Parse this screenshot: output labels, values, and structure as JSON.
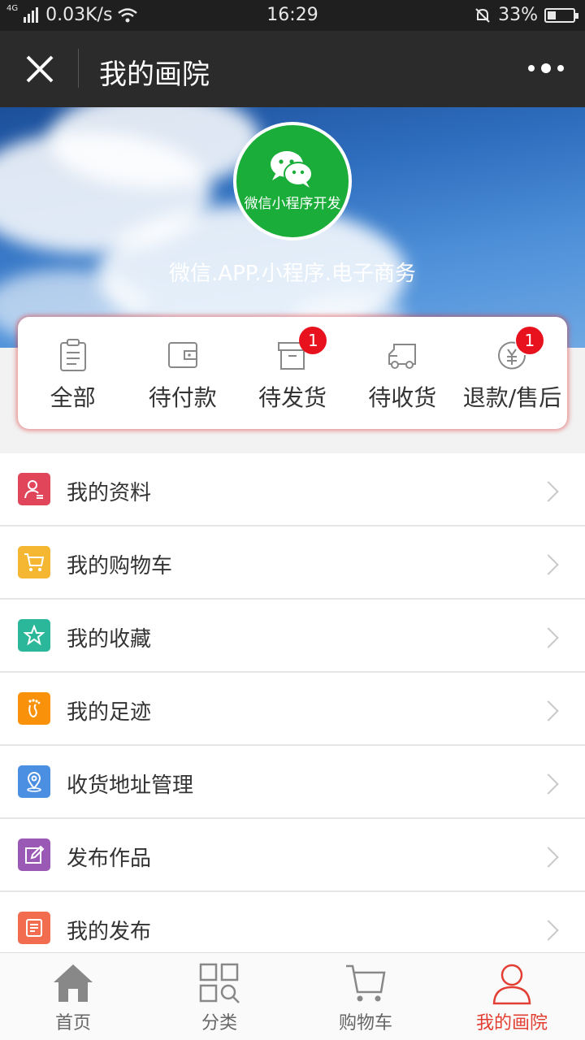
{
  "status_bar": {
    "network_type": "4G",
    "speed": "0.03K/s",
    "time": "16:29",
    "battery": "33%",
    "battery_level": 0.33
  },
  "title_bar": {
    "title": "我的画院"
  },
  "profile": {
    "avatar_text": "微信小程序开发",
    "subtitle": "微信.APP.小程序.电子商务"
  },
  "orders": [
    {
      "label": "全部",
      "icon": "clipboard-icon",
      "badge": ""
    },
    {
      "label": "待付款",
      "icon": "wallet-icon",
      "badge": ""
    },
    {
      "label": "待发货",
      "icon": "box-icon",
      "badge": "1"
    },
    {
      "label": "待收货",
      "icon": "truck-icon",
      "badge": ""
    },
    {
      "label": "退款/售后",
      "icon": "refund-icon",
      "badge": "1"
    }
  ],
  "menu": [
    {
      "label": "我的资料",
      "icon": "profile-icon",
      "color": "#e0455a"
    },
    {
      "label": "我的购物车",
      "icon": "cart-icon",
      "color": "#f5b731"
    },
    {
      "label": "我的收藏",
      "icon": "star-icon",
      "color": "#2bb89a"
    },
    {
      "label": "我的足迹",
      "icon": "footprint-icon",
      "color": "#f9920a"
    },
    {
      "label": "收货地址管理",
      "icon": "location-icon",
      "color": "#4a8fe2"
    },
    {
      "label": "发布作品",
      "icon": "edit-icon",
      "color": "#9b59b6"
    },
    {
      "label": "我的发布",
      "icon": "document-icon",
      "color": "#f26c4f"
    }
  ],
  "tabs": [
    {
      "label": "首页",
      "icon": "home-icon",
      "active": false
    },
    {
      "label": "分类",
      "icon": "category-icon",
      "active": false
    },
    {
      "label": "购物车",
      "icon": "cart-icon",
      "active": false
    },
    {
      "label": "我的画院",
      "icon": "user-icon",
      "active": true
    }
  ],
  "colors": {
    "accent": "#e33e33",
    "badge": "#e8121e",
    "avatar_bg": "#1aad3a",
    "title_bar": "#2b2b2b"
  }
}
